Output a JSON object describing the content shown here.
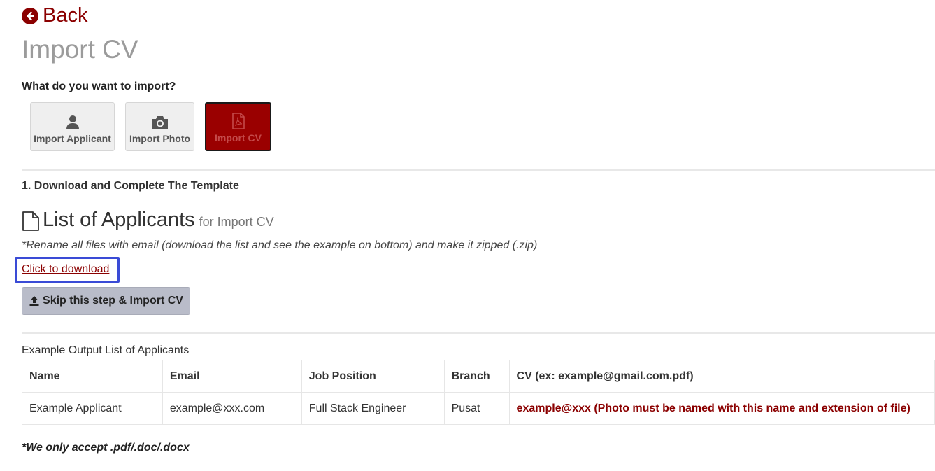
{
  "back": {
    "label": "Back"
  },
  "page": {
    "title": "Import CV"
  },
  "import": {
    "question": "What do you want to import?",
    "options": [
      {
        "label": "Import Applicant",
        "icon": "user-icon"
      },
      {
        "label": "Import Photo",
        "icon": "camera-icon"
      },
      {
        "label": "Import CV",
        "icon": "pdf-file-icon",
        "selected": true
      }
    ]
  },
  "step1": {
    "label": "1. Download and Complete The Template",
    "heading": "List of Applicants",
    "heading_sub": "for Import CV",
    "note": "*Rename all files with email (download the list and see the example on bottom) and make it zipped (.zip)",
    "download_link": "Click to download",
    "skip_button": "Skip this step & Import CV"
  },
  "example": {
    "label": "Example Output List of Applicants",
    "columns": [
      "Name",
      "Email",
      "Job Position",
      "Branch",
      "CV (ex: example@gmail.com.pdf)"
    ],
    "rows": [
      [
        "Example Applicant",
        "example@xxx.com",
        "Full Stack Engineer",
        "Pusat",
        "example@xxx (Photo must be named with this name and extension of file)"
      ]
    ]
  },
  "footer_note": "*We only accept .pdf/.doc/.docx",
  "colors": {
    "accent": "#8b0000",
    "selected_bg": "#9a0000",
    "highlight_frame": "#3a4bd6"
  }
}
